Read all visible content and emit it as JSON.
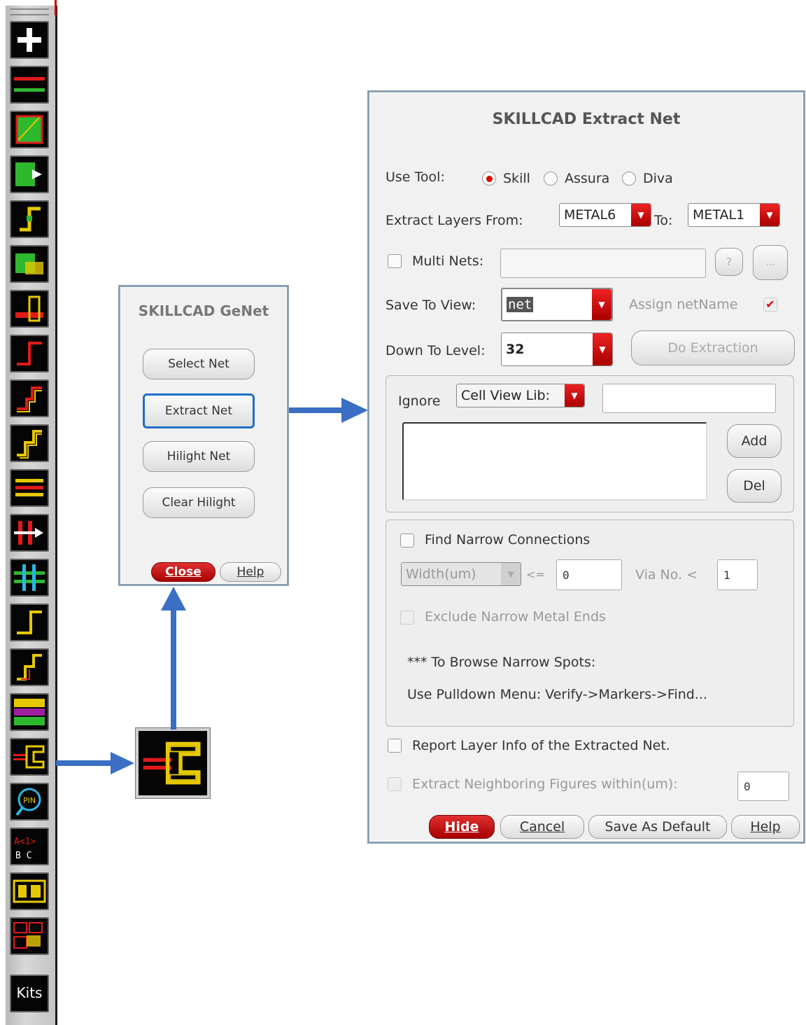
{
  "toolbar": {
    "icons": [
      "add-icon",
      "path-icon",
      "rectangle-fill-icon",
      "move-shape-icon",
      "via-route-icon",
      "multi-layer-icon",
      "stack-icon",
      "corner-route-icon",
      "step-route-icon",
      "double-step-route-icon",
      "bus-route-icon",
      "split-arrow-icon",
      "cross-route-icon",
      "corner-route-2-icon",
      "step-route-2-icon",
      "pattern-fill-icon",
      "genet-icon",
      "pin-search-icon",
      "bus-label-icon",
      "grid-pattern-icon",
      "array-icon"
    ],
    "kits_label": "Kits"
  },
  "genet": {
    "title": "SKILLCAD GeNet",
    "buttons": [
      "Select Net",
      "Extract Net",
      "Hilight Net",
      "Clear Hilight"
    ],
    "close_label": "Close",
    "help_label": "Help"
  },
  "extract": {
    "title": "SKILLCAD Extract Net",
    "use_tool_label": "Use Tool:",
    "tools": [
      "Skill",
      "Assura",
      "Diva"
    ],
    "selected_tool": "Skill",
    "extract_from_label": "Extract Layers From:",
    "from_value": "METAL6",
    "to_label": "To:",
    "to_value": "METAL1",
    "multi_nets_label": "Multi Nets:",
    "multi_nets_value": "",
    "question_label": "?",
    "browse_label": "...",
    "save_view_label": "Save To View:",
    "save_view_value": "net",
    "assign_label": "Assign netName",
    "assign_checked": true,
    "down_level_label": "Down To Level:",
    "down_level_value": "32",
    "do_extraction_label": "Do Extraction",
    "ignore_label": "Ignore",
    "ignore_type": "Cell View Lib:",
    "ignore_value": "",
    "add_label": "Add",
    "del_label": "Del",
    "find_narrow_label": "Find Narrow Connections",
    "width_combo": "Width(um)",
    "le_label": "<=",
    "width_value": "0",
    "via_label": "Via No. <",
    "via_value": "1",
    "exclude_label": "Exclude Narrow Metal Ends",
    "browse_note": "*** To Browse Narrow Spots:",
    "pulldown_note": "Use Pulldown Menu: Verify->Markers->Find...",
    "report_label": "Report Layer Info of the Extracted Net.",
    "neighbor_label": "Extract Neighboring Figures within(um):",
    "neighbor_value": "0",
    "hide_label": "Hide",
    "cancel_label": "Cancel",
    "save_default_label": "Save As Default",
    "help_label": "Help"
  },
  "colors": {
    "accent": "#3a6fc4",
    "danger": "#c00000",
    "dialog_bg": "#f1f1f1"
  }
}
